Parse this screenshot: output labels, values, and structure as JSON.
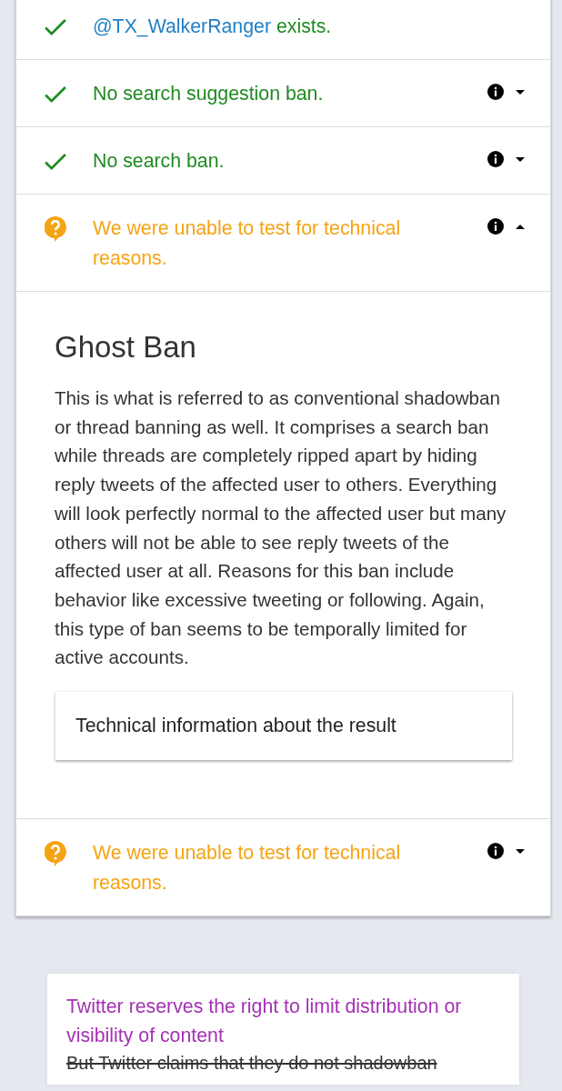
{
  "account_check": {
    "kind": "passed",
    "handle": "@TX_WalkerRanger",
    "text": "exists."
  },
  "tests": [
    {
      "kind": "passed",
      "text": "No search suggestion ban.",
      "expanded": false
    },
    {
      "kind": "passed",
      "text": "No search ban.",
      "expanded": false
    },
    {
      "kind": "unknown",
      "text": "We were unable to test for technical reasons.",
      "expanded": true,
      "details": {
        "title": "Ghost Ban",
        "description": "This is what is referred to as conventional shadowban or thread banning as well. It comprises a search ban while threads are completely ripped apart by hiding reply tweets of the affected user to others. Everything will look perfectly normal to the affected user but many others will not be able to see reply tweets of the affected user at all. Reasons for this ban include behavior like excessive tweeting or following. Again, this type of ban seems to be temporally limited for active accounts.",
        "technical_info": "Technical information about the result"
      }
    },
    {
      "kind": "unknown",
      "text": "We were unable to test for technical reasons.",
      "expanded": false
    }
  ],
  "notice": {
    "title": "Twitter reserves the right to limit distribution or visibility of content",
    "struck_note": "But Twitter claims that they do not shadowban"
  }
}
